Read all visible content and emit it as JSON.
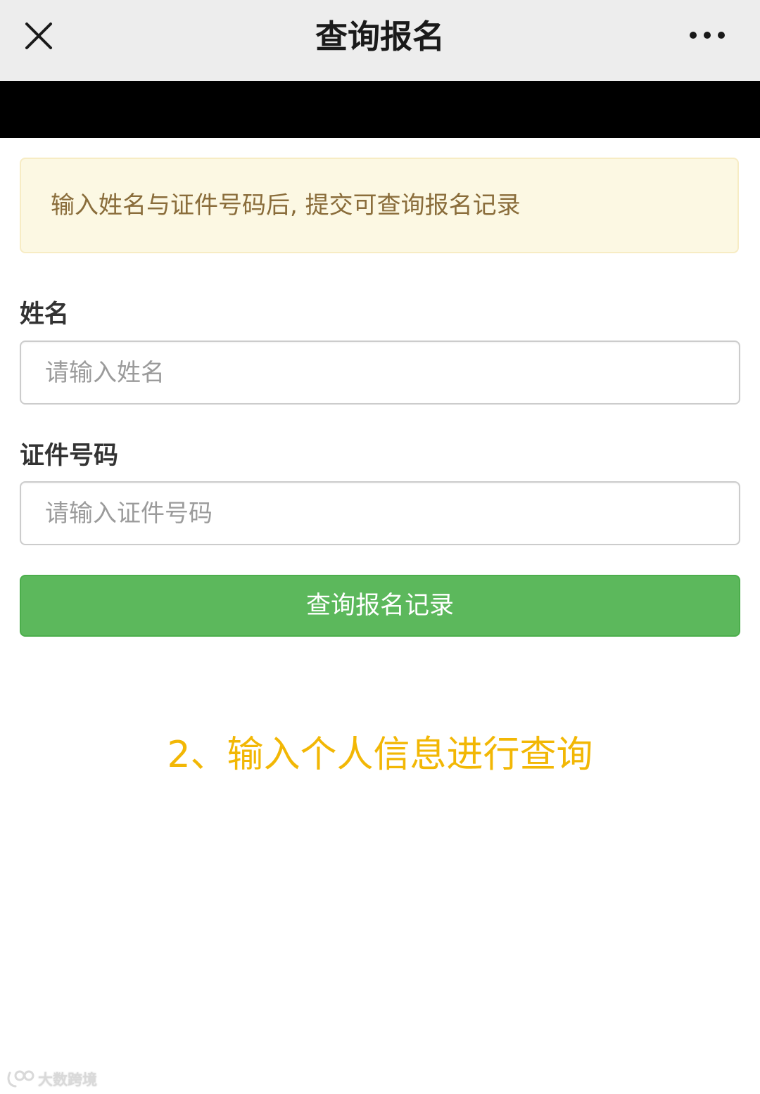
{
  "header": {
    "title": "查询报名",
    "close_icon": "close-icon",
    "more_icon": "more-horizontal-icon",
    "background_color": "#ededed"
  },
  "notice": {
    "text": "输入姓名与证件号码后, 提交可查询报名记录",
    "background_color": "#fcf8e3",
    "text_color": "#8a6d3b"
  },
  "form": {
    "name_label": "姓名",
    "name_placeholder": "请输入姓名",
    "name_value": "",
    "id_label": "证件号码",
    "id_placeholder": "请输入证件号码",
    "id_value": "",
    "submit_label": "查询报名记录",
    "submit_color": "#5cb85c"
  },
  "caption": {
    "text": "2、输入个人信息进行查询",
    "color": "#f2b705"
  },
  "watermark": {
    "text": "大数跨境",
    "icon": "logo-icon"
  }
}
